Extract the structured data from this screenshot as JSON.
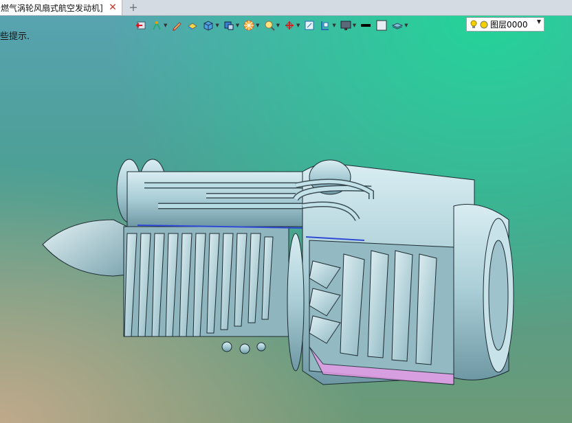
{
  "tab": {
    "title": "燃气涡轮风扇式航空发动机]",
    "close_glyph": "✕",
    "new_tab_glyph": "+"
  },
  "hint_text": "些提示.",
  "toolbar": {
    "icons": [
      "exit-icon",
      "sketch-icon",
      "pencil-icon",
      "face-icon",
      "cube-view-icon",
      "display-mode-icon",
      "render-icon",
      "zoom-icon",
      "orient-icon",
      "frame-icon",
      "section-icon",
      "monitor-icon",
      "line-color-icon",
      "fill-color-icon",
      "layer-stack-icon"
    ]
  },
  "layer": {
    "label": "图层0000",
    "bulb_color": "#f5d000",
    "dot_color": "#f5d000"
  },
  "colors": {
    "metal": "#a9cdd6",
    "metal_dark": "#6e98a4",
    "edge": "#1c2a30",
    "accent_blue": "#2f49d6",
    "accent_pink": "#e49ae6"
  }
}
